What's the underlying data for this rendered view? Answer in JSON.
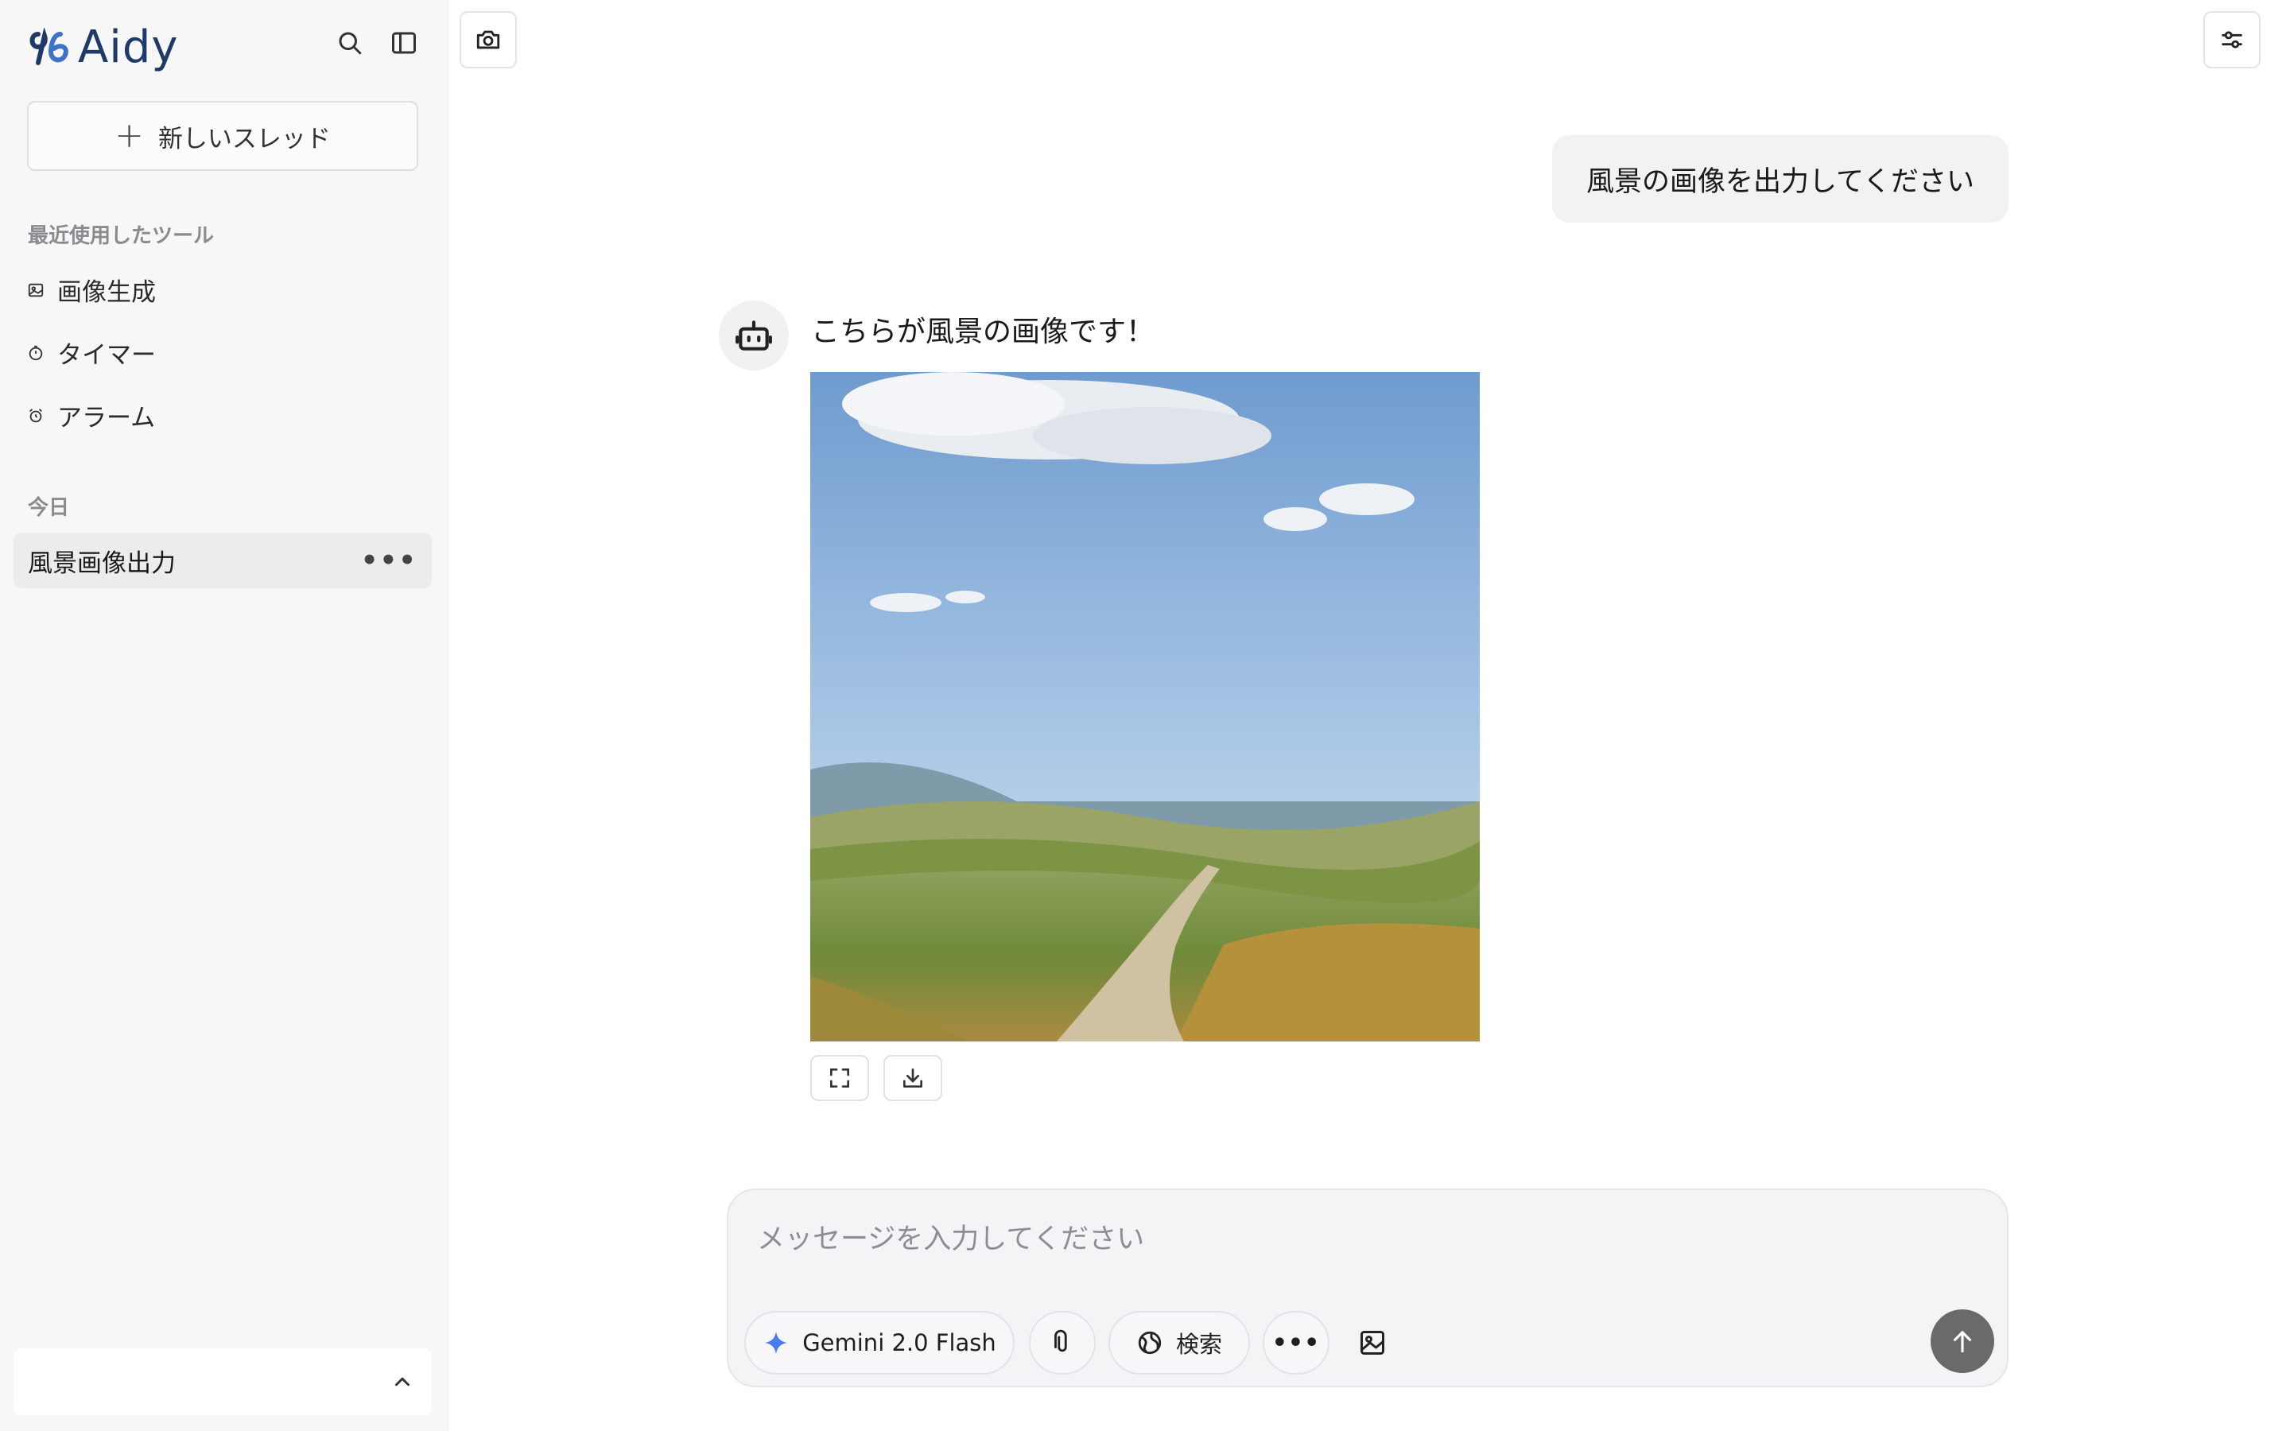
{
  "app": {
    "name": "Aidy"
  },
  "sidebar": {
    "new_thread_label": "新しいスレッド",
    "recent_tools_label": "最近使用したツール",
    "tools": [
      {
        "label": "画像生成",
        "icon": "image-icon"
      },
      {
        "label": "タイマー",
        "icon": "timer-icon"
      },
      {
        "label": "アラーム",
        "icon": "alarm-icon"
      }
    ],
    "today_label": "今日",
    "threads": [
      {
        "label": "風景画像出力",
        "active": true
      }
    ]
  },
  "chat": {
    "user_message": "風景の画像を出力してください",
    "assistant_message": "こちらが風景の画像です！",
    "assistant_image": "landscape-image"
  },
  "composer": {
    "placeholder": "メッセージを入力してください",
    "model_label": "Gemini 2.0 Flash",
    "search_label": "検索"
  },
  "colors": {
    "brand": "#1f3a68",
    "sidebar_bg": "#f7f7f8",
    "send_button": "#6a6a6d"
  }
}
